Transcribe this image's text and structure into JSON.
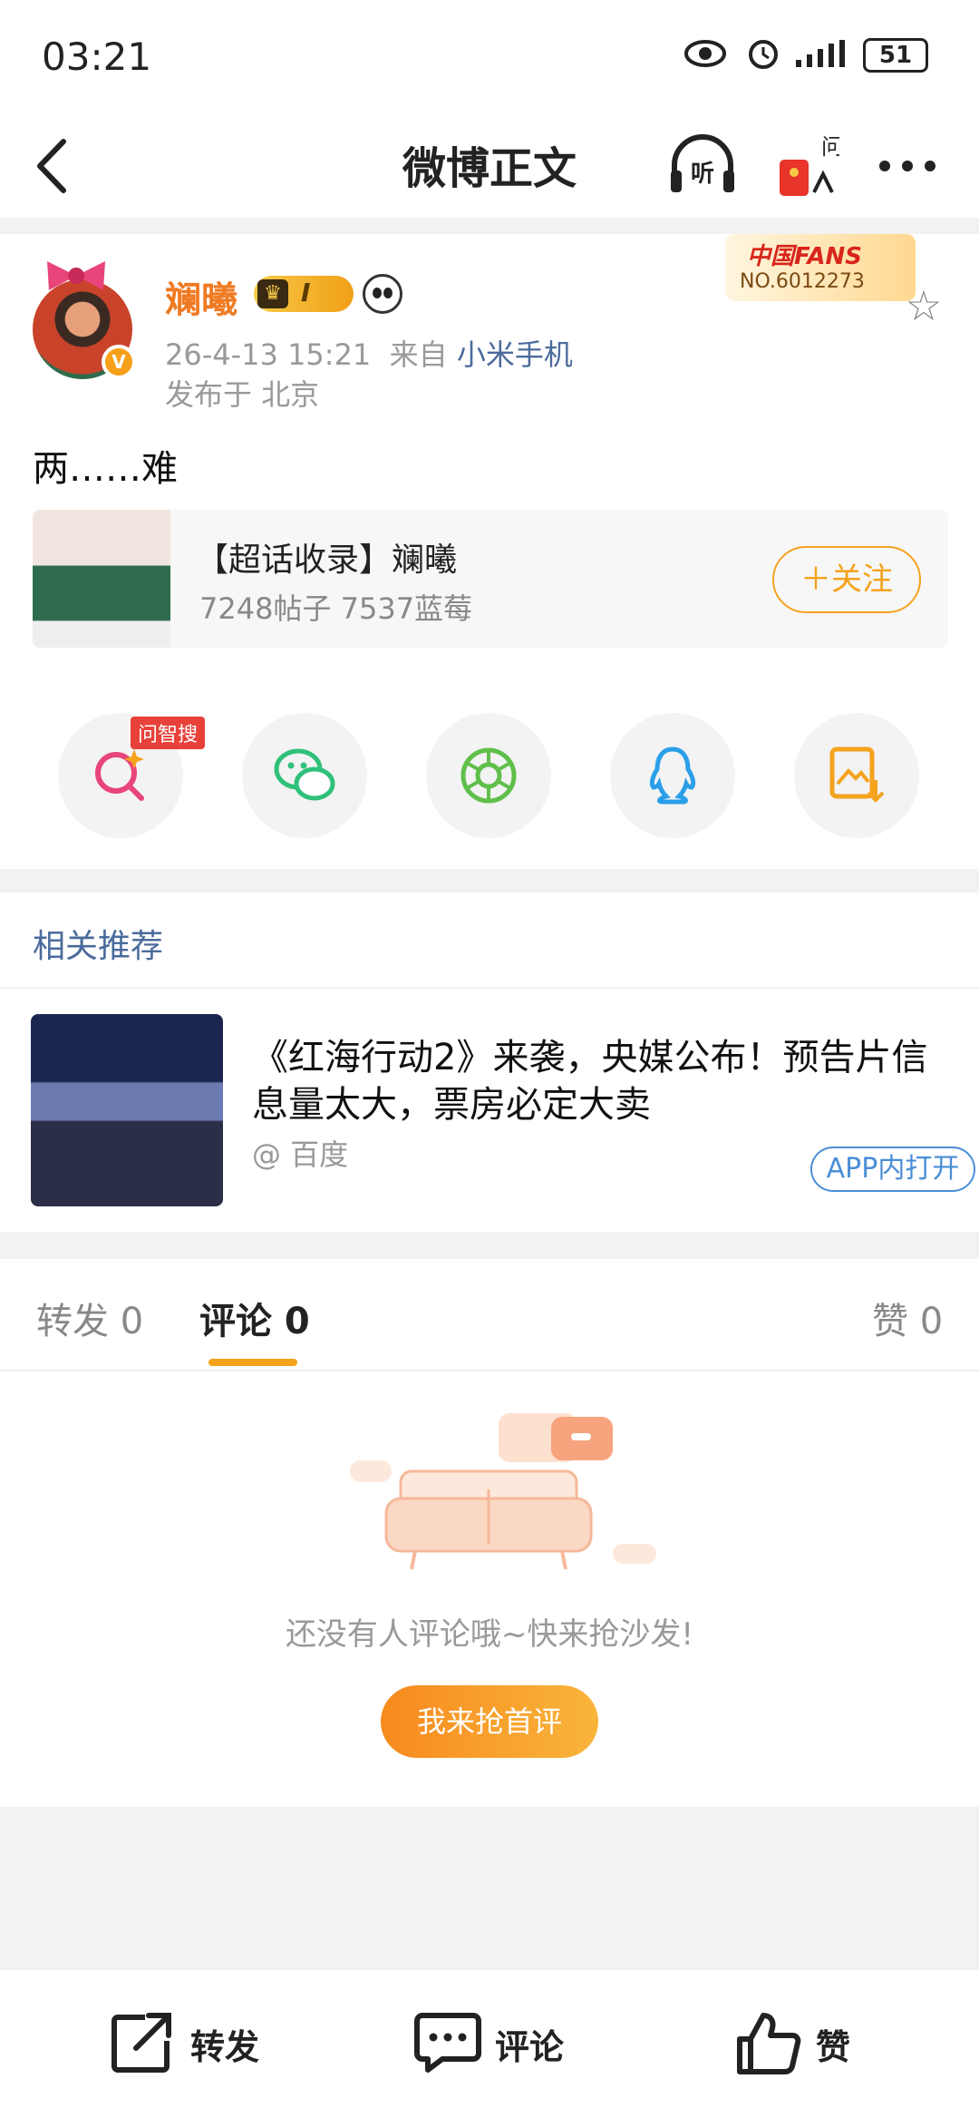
{
  "status_bar": {
    "time": "03:21",
    "battery": "51"
  },
  "nav": {
    "title": "微博正文"
  },
  "post": {
    "author": "斓曦",
    "level": "I",
    "timestamp": "26-4-13 15:21",
    "source_prefix": "来自",
    "source": "小米手机",
    "location": "发布于 北京",
    "fans_badge_title": "中国FANS",
    "fans_badge_no": "NO.6012273",
    "verified_mark": "V",
    "text": "两……难"
  },
  "topic": {
    "name": "【超话收录】斓曦",
    "stats": "7248帖子 7537蓝莓",
    "follow_label": "＋关注"
  },
  "share": {
    "ai_tag": "问智搜",
    "icons": [
      "ai-search-icon",
      "wechat-icon",
      "moments-icon",
      "qq-icon",
      "save-image-icon"
    ]
  },
  "related": {
    "header": "相关推荐",
    "title": "《红海行动2》来袭，央媒公布！预告片信息量太大，票房必定大卖",
    "source": "@ 百度",
    "app_button": "APP内打开"
  },
  "tabs": {
    "repost": "转发 0",
    "comment": "评论 0",
    "like": "赞 0"
  },
  "empty": {
    "message": "还没有人评论哦~快来抢沙发!",
    "cta": "我来抢首评"
  },
  "bottom_bar": {
    "repost": "转发",
    "comment": "评论",
    "like": "赞"
  },
  "colors": {
    "accent": "#f5a21c",
    "link": "#4a6b9c",
    "username": "#f07a22"
  }
}
